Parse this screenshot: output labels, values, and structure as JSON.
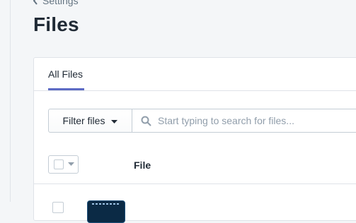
{
  "breadcrumb": {
    "label": "Settings"
  },
  "page": {
    "title": "Files"
  },
  "tabs": [
    {
      "label": "All Files",
      "active": true
    }
  ],
  "toolbar": {
    "filter_label": "Filter files",
    "search_placeholder": "Start typing to search for files..."
  },
  "table": {
    "columns": [
      "File"
    ]
  },
  "colors": {
    "accent": "#5c6ac4",
    "background": "#f4f6f8",
    "text": "#212b36",
    "muted": "#637381"
  },
  "icons": {
    "breadcrumb": "chevron-left-icon",
    "filter": "caret-down-icon",
    "search": "search-icon",
    "bulk": "caret-down-icon"
  }
}
